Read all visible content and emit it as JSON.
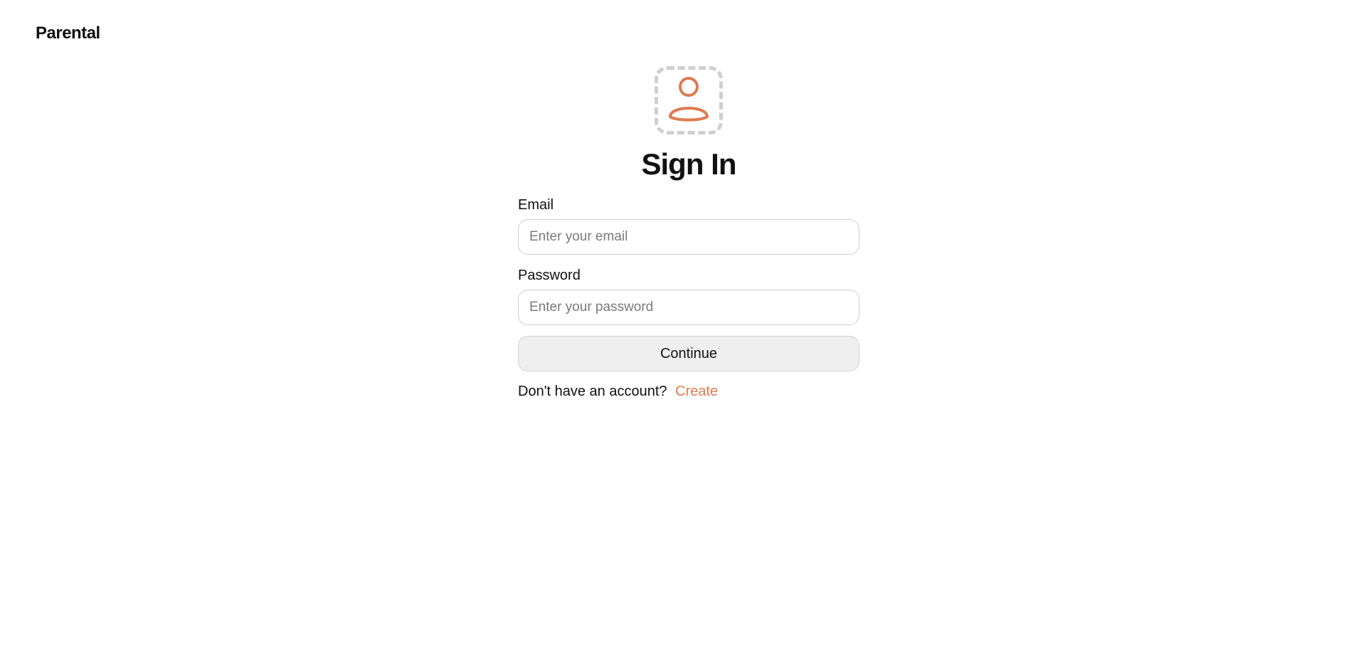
{
  "brand": {
    "name": "Parental"
  },
  "icons": {
    "avatar": "user-icon",
    "accent_color": "#e07a4f",
    "dashed_border_color": "#cfcfcf"
  },
  "signin": {
    "title": "Sign In",
    "email": {
      "label": "Email",
      "value": "",
      "placeholder": "Enter your email"
    },
    "password": {
      "label": "Password",
      "value": "",
      "placeholder": "Enter your password"
    },
    "continue_label": "Continue",
    "no_account_text": "Don't have an account?",
    "create_label": "Create"
  }
}
